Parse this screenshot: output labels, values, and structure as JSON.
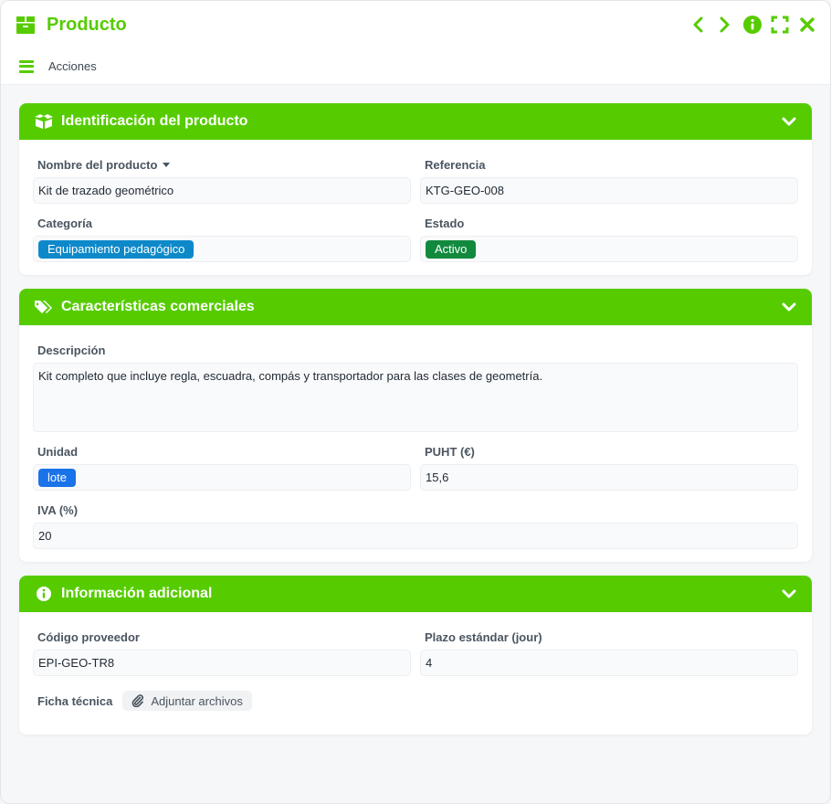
{
  "window": {
    "title": "Producto",
    "icons": [
      "box-icon",
      "chevron-left-icon",
      "chevron-right-icon",
      "info-icon",
      "fullscreen-icon",
      "close-icon"
    ]
  },
  "actions": {
    "label": "Acciones"
  },
  "colors": {
    "accent": "#56cc00",
    "badge_category": "#0d89c9",
    "badge_status": "#118a3d",
    "badge_unit": "#1a73e8"
  },
  "sections": {
    "identification": {
      "title": "Identificación del producto",
      "name_label": "Nombre del producto",
      "name_value": "Kit de trazado geométrico",
      "ref_label": "Referencia",
      "ref_value": "KTG-GEO-008",
      "category_label": "Categoría",
      "category_value": "Equipamiento pedagógico",
      "status_label": "Estado",
      "status_value": "Activo"
    },
    "commercial": {
      "title": "Características comerciales",
      "description_label": "Descripción",
      "description_value": "Kit completo que incluye regla, escuadra, compás y transportador para las clases de geometría.",
      "unit_label": "Unidad",
      "unit_value": "lote",
      "price_label": "PUHT (€)",
      "price_value": "15,6",
      "vat_label": "IVA (%)",
      "vat_value": "20"
    },
    "additional": {
      "title": "Información adicional",
      "supplier_code_label": "Código proveedor",
      "supplier_code_value": "EPI-GEO-TR8",
      "lead_time_label": "Plazo estándar (jour)",
      "lead_time_value": "4",
      "datasheet_label": "Ficha técnica",
      "attach_label": "Adjuntar archivos"
    }
  }
}
